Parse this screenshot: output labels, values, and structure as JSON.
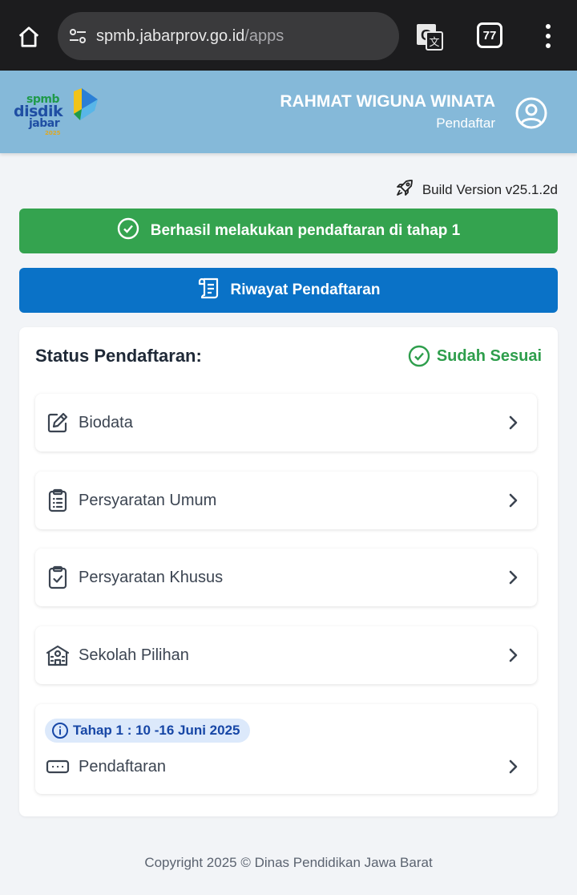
{
  "browser": {
    "url_host": "spmb.jabarprov.go.id",
    "url_path": "/apps",
    "tab_count": "77",
    "icons": [
      "home-icon",
      "site-settings-icon",
      "translate-icon",
      "tabs-icon",
      "more-vert-icon"
    ]
  },
  "header": {
    "logo": {
      "line1": "spmb",
      "line2": "disdik",
      "line3": "jabar",
      "line4": "2025"
    },
    "user_name": "RAHMAT WIGUNA WINATA",
    "user_role": "Pendaftar",
    "avatar_icon": "user-circle-icon"
  },
  "build_version": "Build Version v25.1.2d",
  "alert_success": "Berhasil melakukan pendaftaran di tahap 1",
  "history_button": "Riwayat Pendaftaran",
  "status_card": {
    "title": "Status Pendaftaran:",
    "status": "Sudah Sesuai",
    "items": [
      {
        "label": "Biodata",
        "icon": "edit-icon"
      },
      {
        "label": "Persyaratan Umum",
        "icon": "clipboard-list-icon"
      },
      {
        "label": "Persyaratan Khusus",
        "icon": "clipboard-check-icon"
      },
      {
        "label": "Sekolah Pilihan",
        "icon": "school-icon"
      }
    ],
    "registration": {
      "badge": "Tahap 1 : 10 -16 Juni 2025",
      "label": "Pendaftaran",
      "icon": "input-dots-icon"
    }
  },
  "footer": "Copyright 2025 © Dinas Pendidikan Jawa Barat",
  "colors": {
    "header_bg": "#85b9d9",
    "success": "#34a34f",
    "primary": "#0a72c7",
    "status_green": "#2e9e4c",
    "badge_bg": "#dce9fb",
    "badge_text": "#1747a6"
  }
}
